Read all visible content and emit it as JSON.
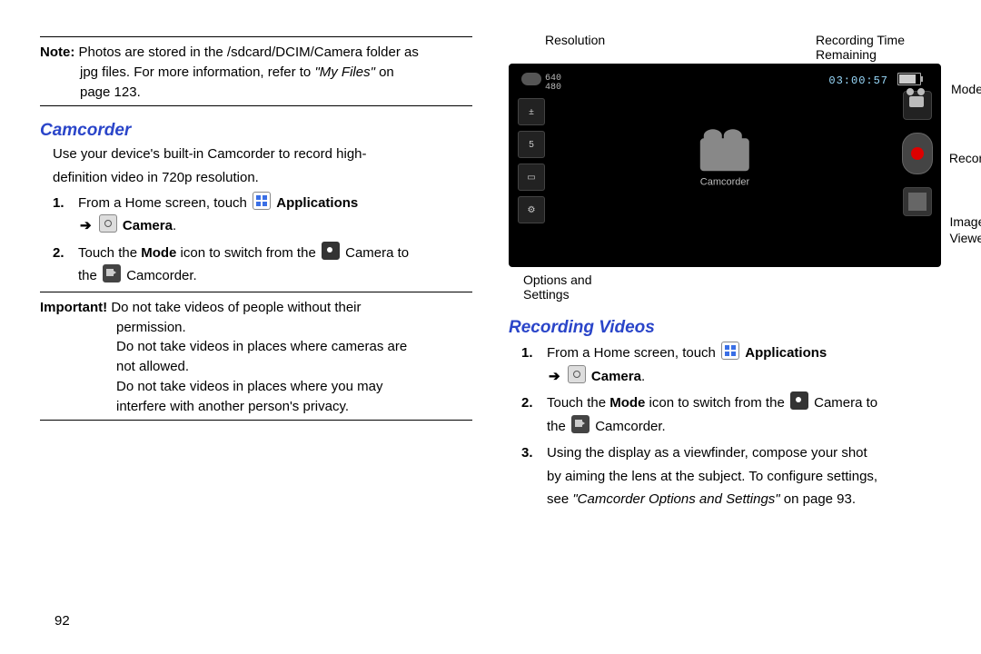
{
  "leftColumn": {
    "note": {
      "lead": "Note:",
      "line1": "Photos are stored in the /sdcard/DCIM/Camera folder as",
      "line2pre": "jpg files. For more information, refer to ",
      "line2ref": "\"My Files\"",
      "line2post": "  on",
      "line3": "page 123."
    },
    "heading": "Camcorder",
    "intro1": "Use your device's built-in Camcorder to record high-",
    "intro2": "definition video in 720p resolution.",
    "step1": {
      "num": "1.",
      "pre": "From a Home screen, touch ",
      "apps": "Applications",
      "arrow": "➔",
      "camera": "Camera",
      "end": "."
    },
    "step2": {
      "num": "2.",
      "a": "Touch the ",
      "mode": "Mode",
      "b": " icon to switch from the ",
      "c": " Camera to",
      "d": "the ",
      "e": " Camcorder."
    },
    "important": {
      "lead": "Important!",
      "l1": "Do not take videos of people without their",
      "l2": "permission.",
      "l3": "Do not take videos in places where cameras are",
      "l4": "not allowed.",
      "l5": "Do not take videos in places where you may",
      "l6": "interfere with another person's privacy."
    }
  },
  "figure": {
    "topLeftLabel": "Resolution",
    "topRightLabel1": "Recording Time",
    "topRightLabel2": "Remaining",
    "resText1": "640",
    "resText2": "480",
    "time": "03:00:57",
    "centerLabel": "Camcorder",
    "sideStripNum": "5",
    "bottomLabel1": "Options and",
    "bottomLabel2": "Settings",
    "rightLblMode": "Mode",
    "rightLblRecord": "Record",
    "rightLblViewer1": "Image",
    "rightLblViewer2": "Viewer"
  },
  "rightColumn": {
    "heading": "Recording Videos",
    "step1": {
      "num": "1.",
      "pre": "From a Home screen, touch ",
      "apps": "Applications",
      "arrow": "➔",
      "camera": "Camera",
      "end": "."
    },
    "step2": {
      "num": "2.",
      "a": "Touch the ",
      "mode": "Mode",
      "b": " icon to switch from the ",
      "c": " Camera to",
      "d": "the ",
      "e": " Camcorder."
    },
    "step3": {
      "num": "3.",
      "a": "Using the display as a viewfinder, compose your shot",
      "b": "by aiming the lens at the subject. To configure settings,",
      "cpre": "see ",
      "cref": "\"Camcorder Options and Settings\"",
      "cpost": " on page 93."
    }
  },
  "pageNum": "92"
}
